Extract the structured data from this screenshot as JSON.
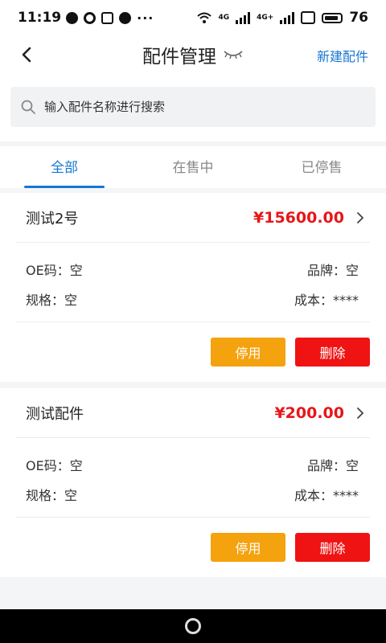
{
  "status_bar": {
    "time": "11:19",
    "network_1": "4G",
    "network_2": "4G+",
    "battery": "76"
  },
  "header": {
    "title": "配件管理",
    "new_button": "新建配件"
  },
  "search": {
    "placeholder": "输入配件名称进行搜索"
  },
  "tabs": [
    {
      "label": "全部",
      "active": true
    },
    {
      "label": "在售中",
      "active": false
    },
    {
      "label": "已停售",
      "active": false
    }
  ],
  "parts": [
    {
      "name": "测试2号",
      "price": "¥15600.00",
      "oe": "OE码：空",
      "brand": "品牌：空",
      "spec": "规格：空",
      "cost": "成本：****",
      "disable_label": "停用",
      "delete_label": "删除"
    },
    {
      "name": "测试配件",
      "price": "¥200.00",
      "oe": "OE码：空",
      "brand": "品牌：空",
      "spec": "规格：空",
      "cost": "成本：****",
      "disable_label": "停用",
      "delete_label": "删除"
    }
  ],
  "colors": {
    "accent": "#1677d2",
    "price": "#e61717",
    "disable_btn": "#f5a20f",
    "delete_btn": "#f01313"
  }
}
